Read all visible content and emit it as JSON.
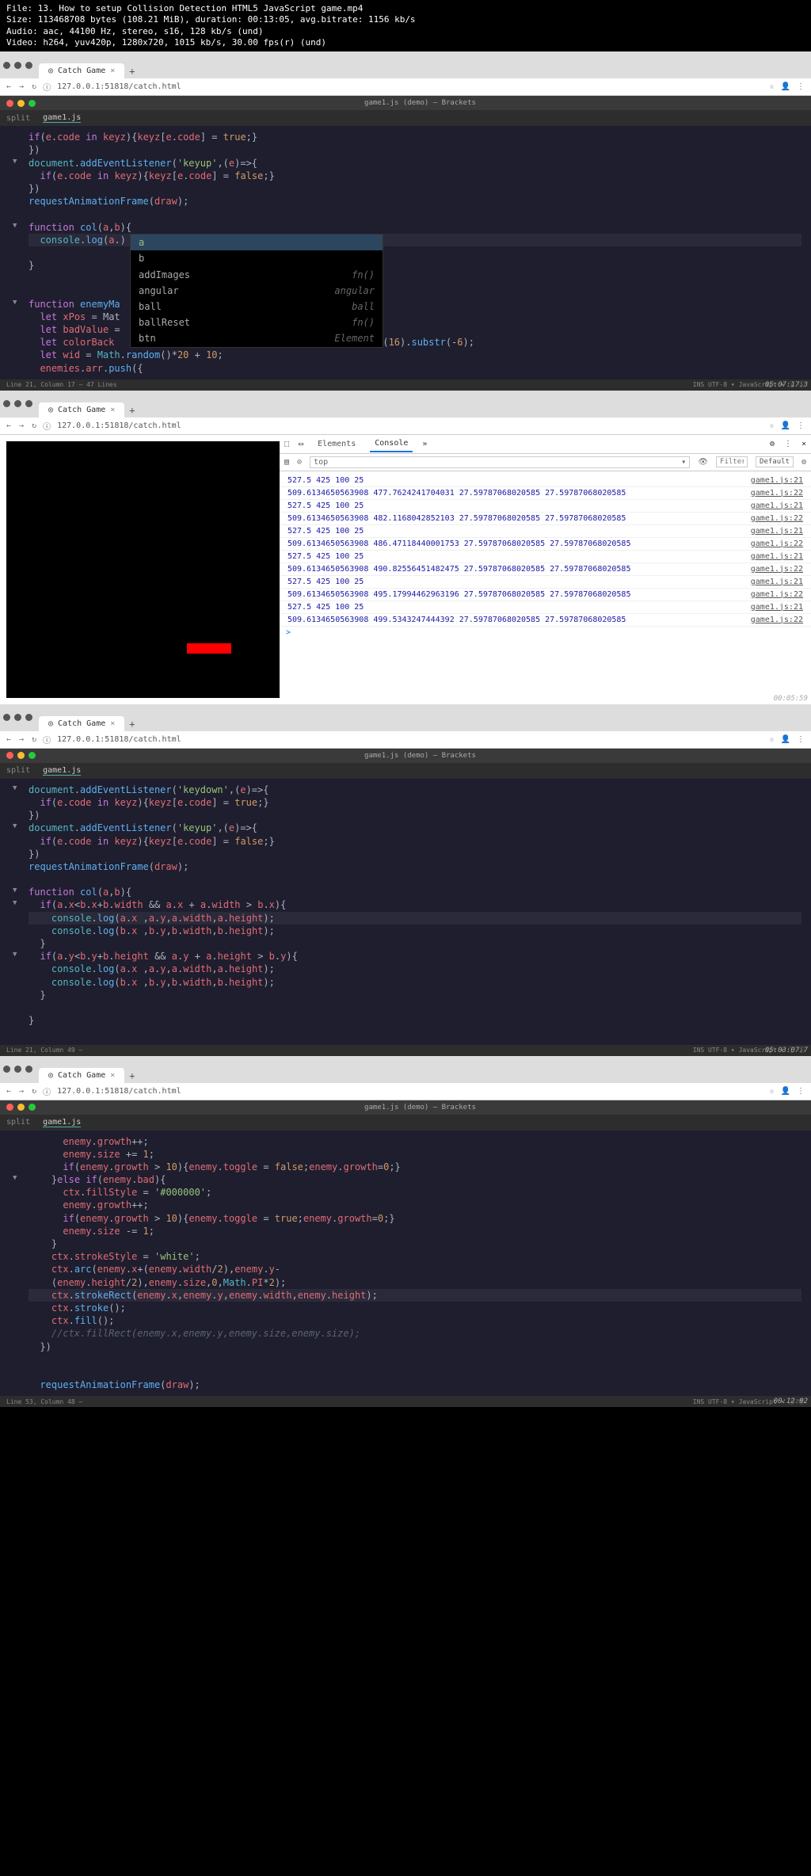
{
  "file_info": {
    "line1": "File: 13. How to setup Collision Detection HTML5 JavaScript game.mp4",
    "line2": "Size: 113468708 bytes (108.21 MiB), duration: 00:13:05, avg.bitrate: 1156 kb/s",
    "line3": "Audio: aac, 44100 Hz, stereo, s16, 128 kb/s (und)",
    "line4": "Video: h264, yuv420p, 1280x720, 1015 kb/s, 30.00 fps(r) (und)"
  },
  "browser": {
    "tab_title": "Catch Game",
    "url": "127.0.0.1:51818/catch.html",
    "new_tab_icon": "+"
  },
  "brackets": {
    "title": "game1.js (demo) — Brackets",
    "tab_name": "game1.js",
    "split_label": "split"
  },
  "panel1": {
    "lines": [
      "    if(e.code in keyz){keyz[e.code] = true;}",
      "  })",
      "  document.addEventListener('keyup',(e)=>{",
      "    if(e.code in keyz){keyz[e.code] = false;}",
      "  })",
      "  requestAnimationFrame(draw);",
      "",
      "  function col(a,b){",
      "    console.log(a.)",
      "",
      "  }",
      "",
      "",
      "  function enemyMa",
      "    let xPos = Mat",
      "    let badValue =",
      "    let colorBack ",
      "    let wid = Math.random()*20 + 10;",
      "    enemies.arr.push({"
    ],
    "autocomplete": [
      {
        "label": "a",
        "hint": ""
      },
      {
        "label": "b",
        "hint": ""
      },
      {
        "label": "addImages",
        "hint": "fn()"
      },
      {
        "label": "angular",
        "hint": "angular"
      },
      {
        "label": "ball",
        "hint": "ball"
      },
      {
        "label": "ballReset",
        "hint": "fn()"
      },
      {
        "label": "btn",
        "hint": "Element"
      }
    ],
    "text_after_ac": "ing(16).substr(-6);",
    "status_left": "Line 21, Column 17 — 47 Lines",
    "timestamp": "05:07:17.3"
  },
  "panel2": {
    "devtools": {
      "tabs": {
        "elements": "Elements",
        "console": "Console"
      },
      "top_dropdown": "top",
      "filter_placeholder": "Filter",
      "default_label": "Default"
    },
    "console": [
      {
        "text": "527.5 425 100 25",
        "link": "game1.js:21"
      },
      {
        "text": "509.6134650563908 477.7624241704031 27.59787068020585 27.59787068020585",
        "link": "game1.js:22"
      },
      {
        "text": "527.5 425 100 25",
        "link": "game1.js:21"
      },
      {
        "text": "509.6134650563908 482.1168042852103 27.59787068020585 27.59787068020585",
        "link": "game1.js:22"
      },
      {
        "text": "527.5 425 100 25",
        "link": "game1.js:21"
      },
      {
        "text": "509.6134650563908 486.47118440001753 27.59787068020585 27.59787068020585",
        "link": "game1.js:22"
      },
      {
        "text": "527.5 425 100 25",
        "link": "game1.js:21"
      },
      {
        "text": "509.6134650563908 490.82556451482475 27.59787068020585 27.59787068020585",
        "link": "game1.js:22"
      },
      {
        "text": "527.5 425 100 25",
        "link": "game1.js:21"
      },
      {
        "text": "509.6134650563908 495.17994462963196 27.59787068020585 27.59787068020585",
        "link": "game1.js:22"
      },
      {
        "text": "527.5 425 100 25",
        "link": "game1.js:21"
      },
      {
        "text": "509.6134650563908 499.5343247444392 27.59787068020585 27.59787068020585",
        "link": "game1.js:22"
      }
    ],
    "timestamp": "00:05:59"
  },
  "panel3": {
    "status_left": "Line 21, Column 49 — ",
    "timestamp": "05:03:07.7"
  },
  "panel4": {
    "status_left": "Line 53, Column 48 — ",
    "timestamp": "00:12:02"
  }
}
